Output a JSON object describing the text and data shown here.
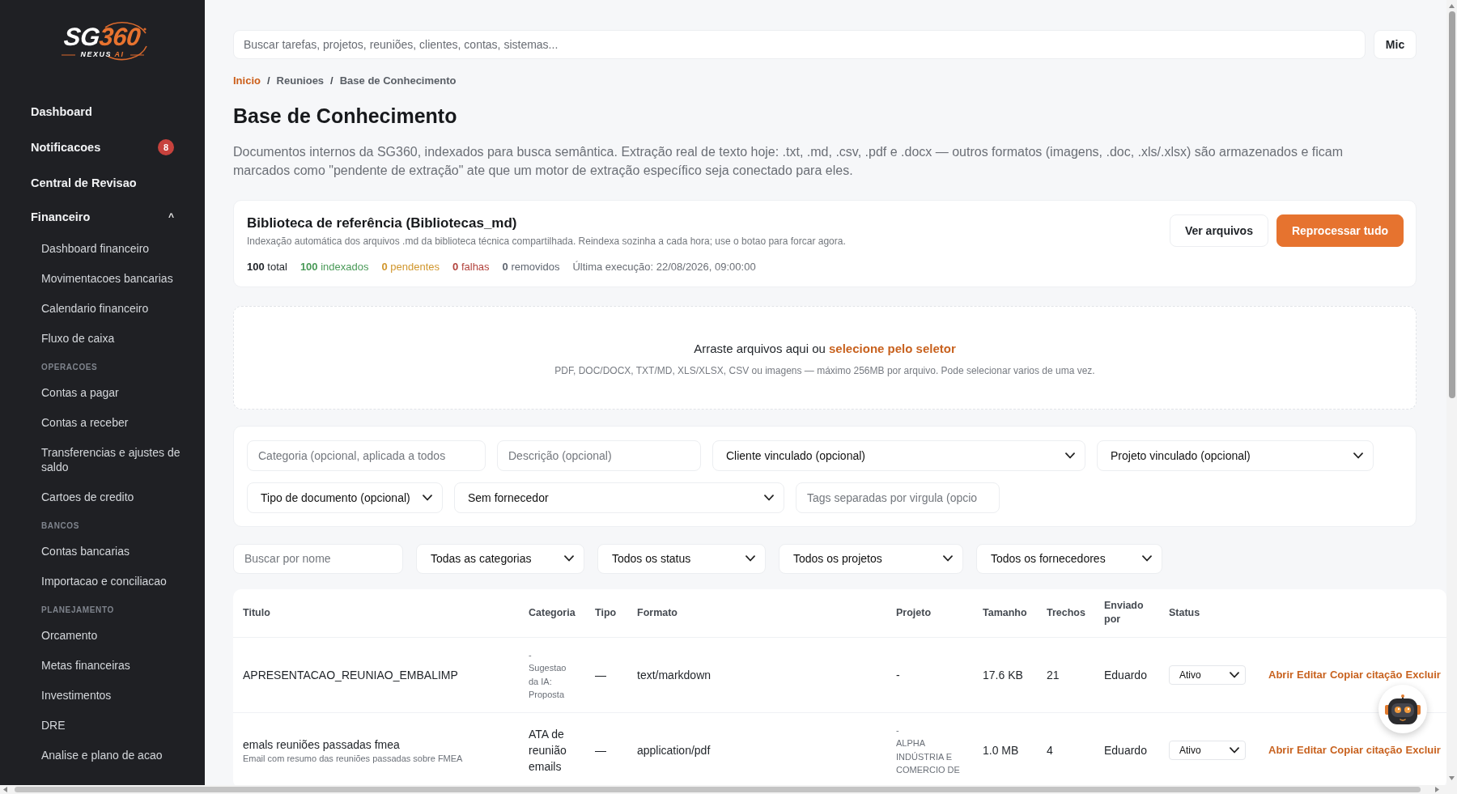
{
  "sidebar": {
    "logo": {
      "mark": [
        "SG",
        "360"
      ],
      "tagline": [
        "NEXUS",
        "AI"
      ]
    },
    "items": [
      {
        "label": "Dashboard"
      },
      {
        "label": "Notificacoes",
        "badge": "8"
      },
      {
        "label": "Central de Revisao"
      },
      {
        "label": "Financeiro",
        "caret": "^",
        "expanded": true,
        "children": [
          {
            "kind": "link",
            "label": "Dashboard financeiro"
          },
          {
            "kind": "link",
            "label": "Movimentacoes bancarias"
          },
          {
            "kind": "link",
            "label": "Calendario financeiro"
          },
          {
            "kind": "link",
            "label": "Fluxo de caixa"
          },
          {
            "kind": "heading",
            "label": "OPERACOES"
          },
          {
            "kind": "link",
            "label": "Contas a pagar"
          },
          {
            "kind": "link",
            "label": "Contas a receber"
          },
          {
            "kind": "link",
            "label": "Transferencias e ajustes de saldo"
          },
          {
            "kind": "link",
            "label": "Cartoes de credito"
          },
          {
            "kind": "heading",
            "label": "BANCOS"
          },
          {
            "kind": "link",
            "label": "Contas bancarias"
          },
          {
            "kind": "link",
            "label": "Importacao e conciliacao"
          },
          {
            "kind": "heading",
            "label": "PLANEJAMENTO"
          },
          {
            "kind": "link",
            "label": "Orcamento"
          },
          {
            "kind": "link",
            "label": "Metas financeiras"
          },
          {
            "kind": "link",
            "label": "Investimentos"
          },
          {
            "kind": "link",
            "label": "DRE"
          },
          {
            "kind": "link",
            "label": "Analise e plano de acao"
          }
        ]
      }
    ]
  },
  "search": {
    "placeholder": "Buscar tarefas, projetos, reuniões, clientes, contas, sistemas...",
    "button": "Mic"
  },
  "breadcrumb": [
    {
      "kind": "link",
      "label": "Inicio"
    },
    {
      "kind": "separator",
      "label": "/"
    },
    {
      "kind": "crumb",
      "label": "Reunioes"
    },
    {
      "kind": "separator",
      "label": "/"
    },
    {
      "kind": "current",
      "label": "Base de Conhecimento"
    }
  ],
  "page": {
    "title": "Base de Conhecimento",
    "description": "Documentos internos da SG360, indexados para busca semântica. Extração real de texto hoje: .txt, .md, .csv, .pdf e .docx — outros formatos (imagens, .doc, .xls/.xlsx) são armazenados e ficam marcados como \"pendente de extração\" ate que um motor de extração específico seja conectado para eles."
  },
  "library": {
    "title": "Biblioteca de referência (Bibliotecas_md)",
    "description": "Indexação automática dos arquivos .md da biblioteca técnica compartilhada. Reindexa sozinha a cada hora; use o botao para forcar agora.",
    "stats": [
      {
        "text": "**100** total",
        "color": "#1f2328"
      },
      {
        "text": "**100** indexados",
        "color": "#4a9a58"
      },
      {
        "text": "**0** pendentes",
        "color": "#d1972e"
      },
      {
        "text": "**0** falhas",
        "color": "#b2433d"
      },
      {
        "text": "**0** removidos",
        "color": "#5f6670"
      }
    ],
    "last_run": "Última execução: 22/08/2026, 09:00:00",
    "buttons": [
      {
        "label": "Ver arquivos",
        "kind": "secondary"
      },
      {
        "label": "Reprocessar tudo",
        "kind": "primary"
      }
    ]
  },
  "dropzone": {
    "text": "Arraste arquivos aqui ou",
    "link": "selecione pelo seletor",
    "hint": "PDF, DOC/DOCX, TXT/MD, XLS/XLSX, CSV ou imagens — máximo 256MB por arquivo. Pode selecionar varios de uma vez."
  },
  "upload_form": {
    "fields": [
      {
        "kind": "input",
        "placeholder": "Categoria (opcional, aplicada a todos"
      },
      {
        "kind": "input",
        "placeholder": "Descrição (opcional)"
      },
      {
        "kind": "select",
        "value": "Cliente vinculado (opcional)"
      },
      {
        "kind": "select",
        "value": "Projeto vinculado (opcional)"
      },
      {
        "kind": "select",
        "value": "Tipo de documento (opcional)"
      },
      {
        "kind": "select",
        "value": "Sem fornecedor"
      },
      {
        "kind": "input",
        "placeholder": "Tags separadas por virgula (opcio"
      }
    ]
  },
  "filters": [
    {
      "kind": "input",
      "placeholder": "Buscar por nome"
    },
    {
      "kind": "select",
      "value": "Todas as categorias"
    },
    {
      "kind": "select",
      "value": "Todos os status"
    },
    {
      "kind": "select",
      "value": "Todos os projetos"
    },
    {
      "kind": "select",
      "value": "Todos os fornecedores"
    }
  ],
  "table": {
    "columns": [
      "Titulo",
      "Categoria",
      "Tipo",
      "Formato",
      "Projeto",
      "Tamanho",
      "Trechos",
      "Enviado por",
      "Status"
    ],
    "rows": [
      {
        "title": "APRESENTACAO_REUNIAO_EMBALIMP",
        "category": {
          "kind": "stacked",
          "lines": [
            "-",
            "Sugestao da IA: Proposta"
          ]
        },
        "type": "—",
        "format": "text/markdown",
        "project": {
          "kind": "plain",
          "lines": [
            "-"
          ]
        },
        "size": "17.6 KB",
        "chunks": "21",
        "sent_by": "Eduardo",
        "status": "Ativo",
        "actions": [
          "Abrir",
          "Editar",
          "Copiar citação",
          "Excluir"
        ]
      },
      {
        "title": "emals reuniões passadas fmea",
        "subtitle": "Email com resumo das reuniões passadas sobre FMEA",
        "category": {
          "kind": "plain",
          "lines": [
            "ATA de reunião emails"
          ]
        },
        "type": "—",
        "format": "application/pdf",
        "project": {
          "kind": "stacked",
          "lines": [
            "-",
            "ALPHA INDÚSTRIA E COMERCIO DE"
          ]
        },
        "size": "1.0 MB",
        "chunks": "4",
        "sent_by": "Eduardo",
        "status": "Ativo",
        "actions": [
          "Abrir",
          "Editar",
          "Copiar citação",
          "Excluir"
        ]
      }
    ]
  }
}
